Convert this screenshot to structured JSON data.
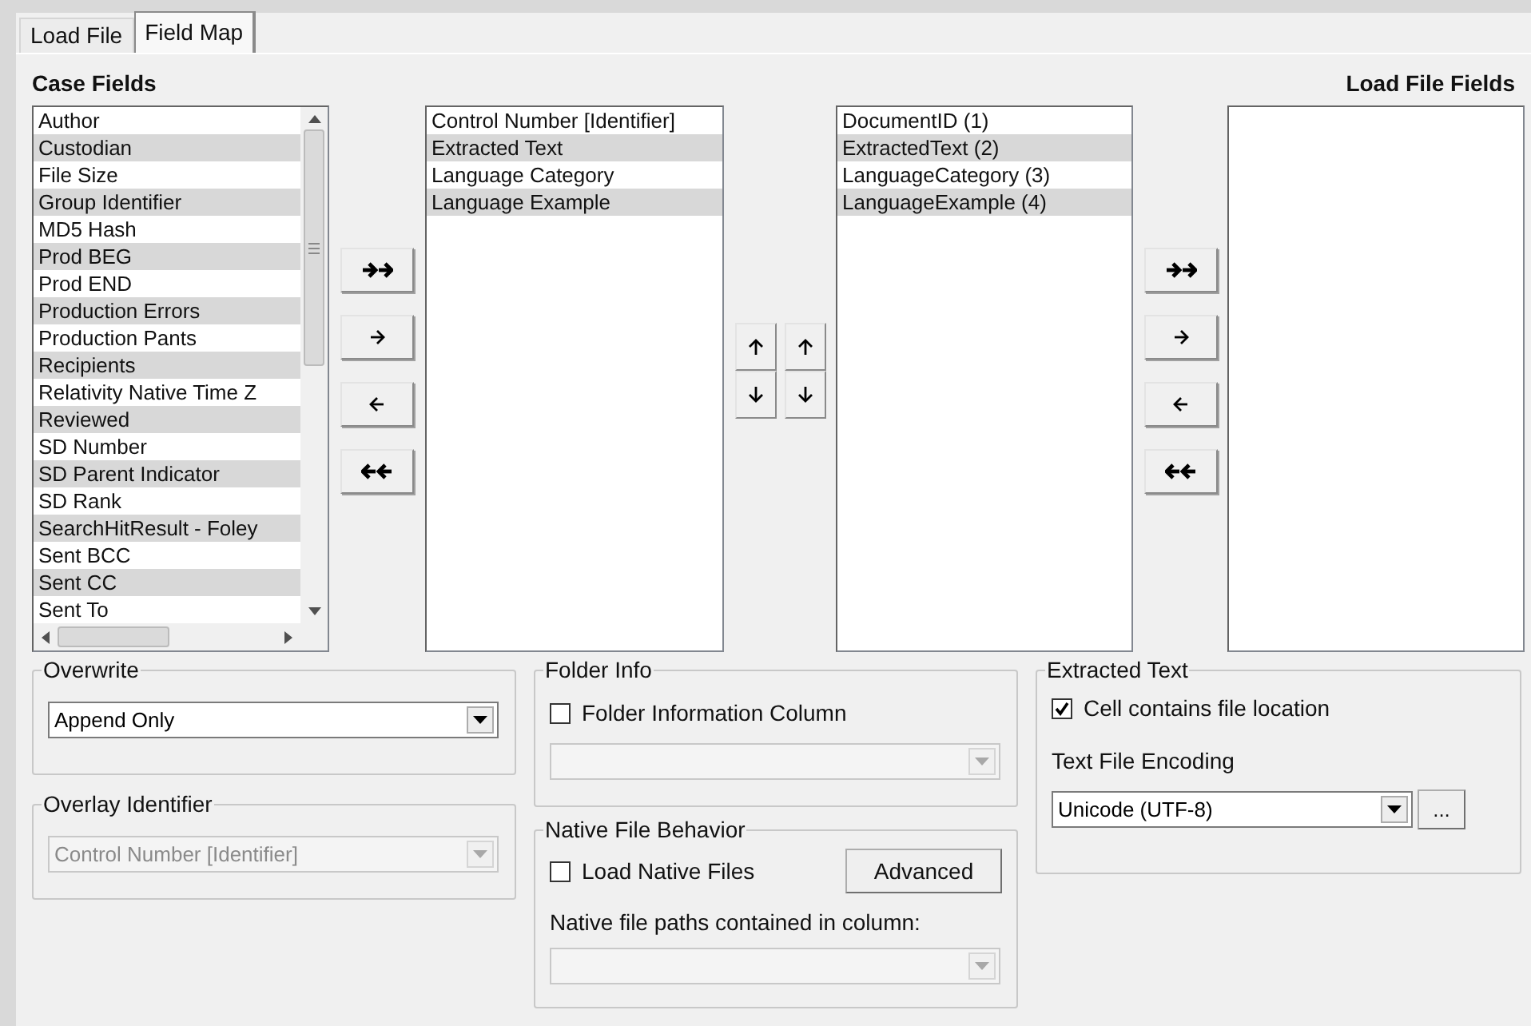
{
  "tabs": [
    {
      "label": "Load File",
      "selected": false
    },
    {
      "label": "Field Map",
      "selected": true
    }
  ],
  "case_fields": {
    "title": "Case Fields",
    "items": [
      "Author",
      "Custodian",
      "File Size",
      "Group Identifier",
      "MD5 Hash",
      "Prod BEG",
      "Prod END",
      "Production Errors",
      "Production Pants",
      "Recipients",
      "Relativity Native Time Z",
      "Reviewed",
      "SD Number",
      "SD Parent Indicator",
      "SD Rank",
      "SearchHitResult - Foley",
      "Sent BCC",
      "Sent CC",
      "Sent To"
    ]
  },
  "mapped_case_fields": {
    "items": [
      "Control Number [Identifier]",
      "Extracted Text",
      "Language Category",
      "Language Example"
    ]
  },
  "mapped_load_file_fields": {
    "items": [
      "DocumentID (1)",
      "ExtractedText (2)",
      "LanguageCategory (3)",
      "LanguageExample (4)"
    ]
  },
  "load_file_fields": {
    "title": "Load File Fields"
  },
  "overwrite": {
    "title": "Overwrite",
    "value": "Append Only",
    "disabled": false
  },
  "overlay_identifier": {
    "title": "Overlay Identifier",
    "value": "Control Number [Identifier]",
    "disabled": true
  },
  "folder_info": {
    "title": "Folder Info",
    "checkbox": {
      "label": "Folder Information Column",
      "checked": false
    },
    "dropdown": {
      "disabled": true
    }
  },
  "native_file_behavior": {
    "title": "Native File Behavior",
    "checkbox": {
      "label": "Load Native Files",
      "checked": false
    },
    "button": "Advanced",
    "column_label": "Native file paths contained in column:",
    "dropdown": {
      "disabled": true
    }
  },
  "extracted_text": {
    "title": "Extracted Text",
    "checkbox": {
      "label": "Cell contains file location",
      "checked": true
    },
    "encoding_label": "Text File Encoding",
    "encoding": {
      "value": "Unicode (UTF-8)",
      "disabled": false
    },
    "browse_button": "..."
  }
}
